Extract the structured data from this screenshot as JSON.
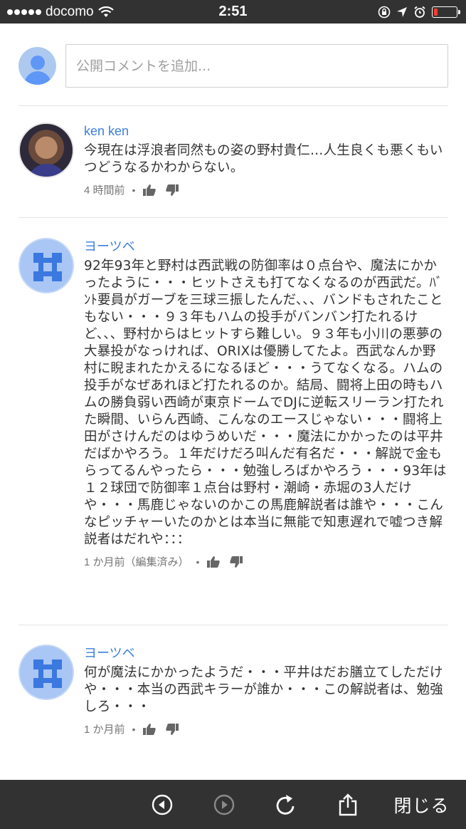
{
  "status_bar": {
    "carrier": "docomo",
    "time": "2:51",
    "battery_level": 0.15,
    "battery_color": "#ff3b30"
  },
  "add_comment": {
    "placeholder": "公開コメントを追加..."
  },
  "comments": [
    {
      "author": "ken ken",
      "text": "今現在は浮浪者同然もの姿の野村貴仁…人生良くも悪くもいつどうなるかわからない。",
      "time": "4 時間前",
      "avatar": "person-photo"
    },
    {
      "author": "ヨーツベ",
      "text": "92年93年と野村は西武戦の防御率は０点台や、魔法にかかったように・・・ヒットさえも打てなくなるのが西武だ。ﾊﾞﾝﾄ要員がガーブを三球三振したんだ、、、バンドもされたこともない・・・９３年もハムの投手がバンバン打たれるけど、、、野村からはヒットすら難しい。９３年も小川の悪夢の大暴投がなっければ、ORIXは優勝してたよ。西武なんか野村に睨まれたかえるになるほど・・・うてなくなる。ハムの投手がなぜあれほど打たれるのか。結局、闘将上田の時もハムの勝負弱い西崎が東京ドームでDJに逆転スリーラン打たれた瞬間、いらん西崎、こんなのエースじゃない・・・闘将上田がさけんだのはゆうめいだ・・・魔法にかかったのは平井だばかやろう。１年だけだろ叫んだ有名だ・・・解説で金もらってるんやったら・・・勉強しろばかやろう・・・93年は１２球団で防御率１点台は野村・潮崎・赤堀の3人だけや・・・馬鹿じゃないのかこの馬鹿解説者は誰や・・・こんなピッチャーいたのかとは本当に無能で知恵遅れで嘘つき解説者はだれや：：：",
      "time": "1 か月前（編集済み）",
      "avatar": "blue-tile"
    },
    {
      "author": "ヨーツベ",
      "text": "何が魔法にかかったようだ・・・平井はだお膳立てしただけや・・・本当の西武キラーが誰か・・・この解説者は、勉強しろ・・・",
      "time": "1 か月前",
      "avatar": "blue-tile"
    }
  ],
  "toolbar": {
    "close_label": "閉じる",
    "icons": [
      "back-icon",
      "forward-icon",
      "reload-icon",
      "share-icon"
    ]
  },
  "colors": {
    "author": "#3b7fdc",
    "bar_background": "#323232"
  }
}
